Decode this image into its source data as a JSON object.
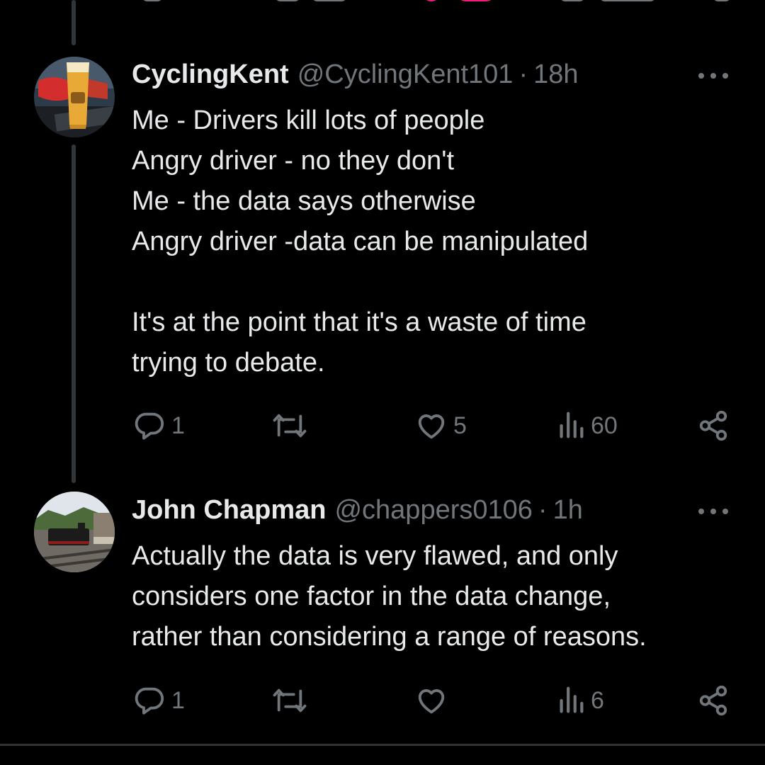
{
  "colors": {
    "background": "#000000",
    "text_primary": "#e7e9ea",
    "text_secondary": "#71767b",
    "like_accent": "#f91880",
    "thread_line": "#333639"
  },
  "tweets": [
    {
      "display_name": "CyclingKent",
      "handle": "@CyclingKent101",
      "separator": "·",
      "time": "18h",
      "text": "Me - Drivers kill lots of people\nAngry driver - no they don't\nMe - the data says otherwise\nAngry driver -data can be manipulated\n\nIt's at the point that it's a waste of time\ntrying to debate.",
      "stats": {
        "replies": "1",
        "retweets": "",
        "likes": "5",
        "views": "60"
      },
      "icons": {
        "reply": "reply-icon",
        "retweet": "retweet-icon",
        "like": "heart-icon",
        "views": "views-icon",
        "share": "share-icon",
        "more": "more-icon"
      }
    },
    {
      "display_name": "John Chapman",
      "handle": "@chappers0106",
      "separator": "·",
      "time": "1h",
      "text": "Actually the data is very flawed, and only\nconsiders one factor in the data change,\nrather than considering a range of reasons.",
      "stats": {
        "replies": "1",
        "retweets": "",
        "likes": "",
        "views": "6"
      },
      "icons": {
        "reply": "reply-icon",
        "retweet": "retweet-icon",
        "like": "heart-icon",
        "views": "views-icon",
        "share": "share-icon",
        "more": "more-icon"
      }
    }
  ]
}
